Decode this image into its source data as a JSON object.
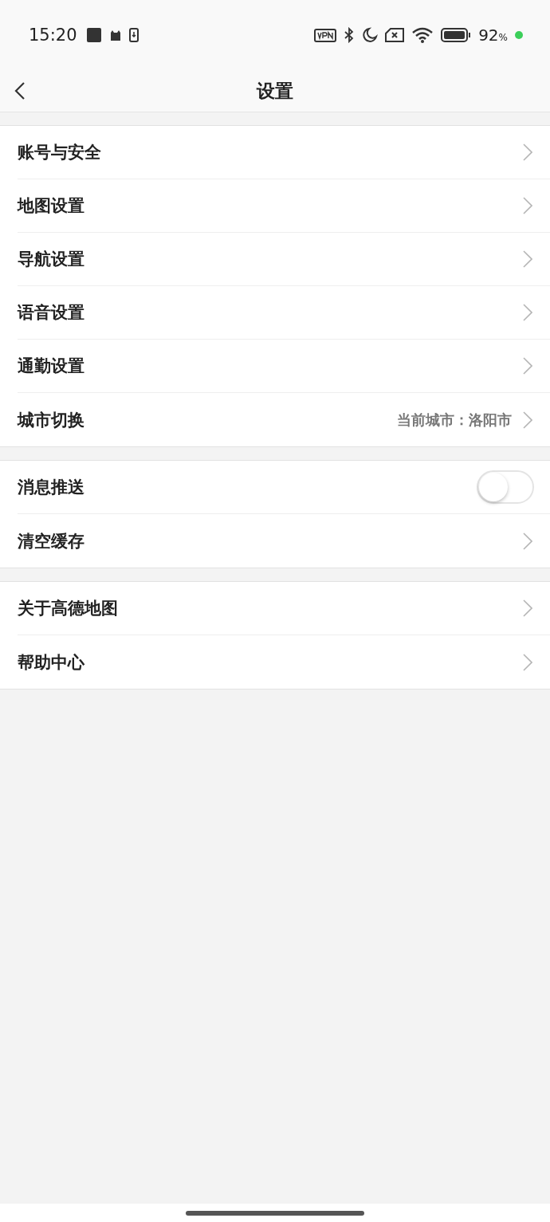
{
  "status_bar": {
    "time": "15:20",
    "battery": "92",
    "battery_unit": "%"
  },
  "header": {
    "title": "设置"
  },
  "groups": [
    {
      "items": [
        {
          "kind": "link",
          "label": "账号与安全"
        },
        {
          "kind": "link",
          "label": "地图设置"
        },
        {
          "kind": "link",
          "label": "导航设置"
        },
        {
          "kind": "link",
          "label": "语音设置"
        },
        {
          "kind": "link",
          "label": "通勤设置"
        },
        {
          "kind": "link",
          "label": "城市切换",
          "value": "当前城市：洛阳市"
        }
      ]
    },
    {
      "items": [
        {
          "kind": "toggle",
          "label": "消息推送",
          "on": false
        },
        {
          "kind": "link",
          "label": "清空缓存"
        }
      ]
    },
    {
      "items": [
        {
          "kind": "link",
          "label": "关于高德地图"
        },
        {
          "kind": "link",
          "label": "帮助中心"
        }
      ]
    }
  ]
}
